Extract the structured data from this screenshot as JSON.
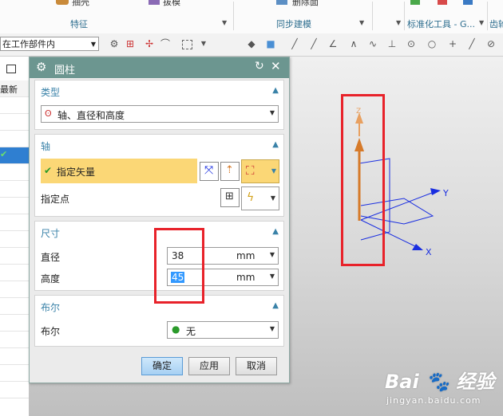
{
  "ribbon": {
    "items": [
      {
        "label": "抽壳"
      },
      {
        "label": "拔模"
      },
      {
        "label": "删除面"
      }
    ],
    "groups": [
      {
        "label": "特征"
      },
      {
        "label": "同步建模"
      },
      {
        "label": "标准化工具 - G..."
      },
      {
        "label": "齿轮"
      }
    ]
  },
  "toolbar": {
    "scope_value": "在工作部件内"
  },
  "left_panel": {
    "header_label": "最新"
  },
  "dialog": {
    "title": "圆柱",
    "type_section": {
      "title": "类型",
      "value": "轴、直径和高度"
    },
    "axis_section": {
      "title": "轴",
      "vector_label": "指定矢量",
      "point_label": "指定点"
    },
    "dimension_section": {
      "title": "尺寸",
      "diameter_label": "直径",
      "diameter_value": "38",
      "diameter_unit": "mm",
      "height_label": "高度",
      "height_value": "45",
      "height_unit": "mm"
    },
    "boolean_section": {
      "title": "布尔",
      "label": "布尔",
      "value": "无"
    },
    "buttons": {
      "ok": "确定",
      "apply": "应用",
      "cancel": "取消"
    }
  },
  "viewport": {
    "axis_labels": {
      "x": "X",
      "y": "Y",
      "z": "Z"
    }
  },
  "watermark": {
    "brand": "Bai",
    "brand2": "经验",
    "url": "jingyan.baidu.com"
  },
  "colors": {
    "title_bar": "#6c9690",
    "section_header": "#3a82a8",
    "highlight_row": "#fbd776",
    "annotation_red": "#e8222a",
    "axis_blue": "#1a2ee0",
    "vector_orange": "#d67a2a"
  }
}
